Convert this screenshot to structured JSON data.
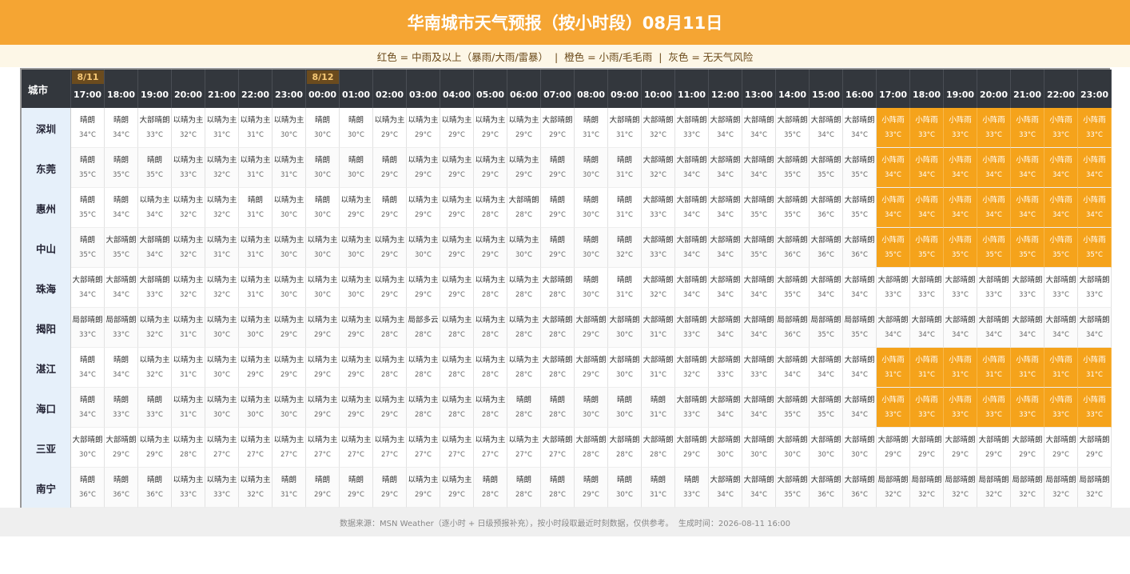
{
  "title": "华南城市天气预报（按小时段）08月11日",
  "legend": "红色 = 中雨及以上（暴雨/大雨/雷暴）  |  橙色 = 小雨/毛毛雨  |  灰色 = 无天气风险",
  "footer": "数据来源：MSN Weather（逐小时 + 日级预报补充），按小时段取最近时刻数据，仅供参考。  生成时间：2026-08-11 16:00",
  "colors": {
    "header": "#f5a533",
    "rain_cell": "#f5a31b",
    "header_row": "#33373d",
    "date_badge": "#6b4b1e",
    "city_col": "#e6f0fa"
  },
  "table": {
    "corner": "城市",
    "date_badges": [
      {
        "col": 0,
        "label": "8/11"
      },
      {
        "col": 7,
        "label": "8/12"
      }
    ],
    "hours": [
      "17:00",
      "18:00",
      "19:00",
      "20:00",
      "21:00",
      "22:00",
      "23:00",
      "00:00",
      "01:00",
      "02:00",
      "03:00",
      "04:00",
      "05:00",
      "06:00",
      "07:00",
      "08:00",
      "09:00",
      "10:00",
      "11:00",
      "12:00",
      "13:00",
      "14:00",
      "15:00",
      "16:00",
      "17:00",
      "18:00",
      "19:00",
      "20:00",
      "21:00",
      "22:00",
      "23:00"
    ],
    "rows": [
      {
        "city": "深圳",
        "cond": [
          "晴朗",
          "晴朗",
          "大部晴朗",
          "以晴为主",
          "以晴为主",
          "以晴为主",
          "以晴为主",
          "晴朗",
          "晴朗",
          "以晴为主",
          "以晴为主",
          "以晴为主",
          "以晴为主",
          "以晴为主",
          "大部晴朗",
          "晴朗",
          "大部晴朗",
          "大部晴朗",
          "大部晴朗",
          "大部晴朗",
          "大部晴朗",
          "大部晴朗",
          "大部晴朗",
          "大部晴朗",
          "小阵雨",
          "小阵雨",
          "小阵雨",
          "小阵雨",
          "小阵雨",
          "小阵雨",
          "小阵雨"
        ],
        "temp": [
          "34°C",
          "34°C",
          "33°C",
          "32°C",
          "31°C",
          "31°C",
          "30°C",
          "30°C",
          "30°C",
          "29°C",
          "29°C",
          "29°C",
          "29°C",
          "29°C",
          "29°C",
          "31°C",
          "31°C",
          "32°C",
          "33°C",
          "34°C",
          "34°C",
          "35°C",
          "34°C",
          "34°C",
          "33°C",
          "33°C",
          "33°C",
          "33°C",
          "33°C",
          "33°C",
          "33°C"
        ]
      },
      {
        "city": "东莞",
        "cond": [
          "晴朗",
          "晴朗",
          "晴朗",
          "以晴为主",
          "以晴为主",
          "以晴为主",
          "以晴为主",
          "晴朗",
          "晴朗",
          "晴朗",
          "以晴为主",
          "以晴为主",
          "以晴为主",
          "以晴为主",
          "晴朗",
          "晴朗",
          "晴朗",
          "大部晴朗",
          "大部晴朗",
          "大部晴朗",
          "大部晴朗",
          "大部晴朗",
          "大部晴朗",
          "大部晴朗",
          "小阵雨",
          "小阵雨",
          "小阵雨",
          "小阵雨",
          "小阵雨",
          "小阵雨",
          "小阵雨"
        ],
        "temp": [
          "35°C",
          "35°C",
          "35°C",
          "33°C",
          "32°C",
          "31°C",
          "31°C",
          "30°C",
          "30°C",
          "29°C",
          "29°C",
          "29°C",
          "29°C",
          "29°C",
          "29°C",
          "30°C",
          "31°C",
          "32°C",
          "34°C",
          "34°C",
          "34°C",
          "35°C",
          "35°C",
          "35°C",
          "34°C",
          "34°C",
          "34°C",
          "34°C",
          "34°C",
          "34°C",
          "34°C"
        ]
      },
      {
        "city": "惠州",
        "cond": [
          "晴朗",
          "晴朗",
          "以晴为主",
          "以晴为主",
          "以晴为主",
          "晴朗",
          "以晴为主",
          "晴朗",
          "以晴为主",
          "晴朗",
          "以晴为主",
          "以晴为主",
          "以晴为主",
          "大部晴朗",
          "晴朗",
          "晴朗",
          "晴朗",
          "大部晴朗",
          "大部晴朗",
          "大部晴朗",
          "大部晴朗",
          "大部晴朗",
          "大部晴朗",
          "大部晴朗",
          "小阵雨",
          "小阵雨",
          "小阵雨",
          "小阵雨",
          "小阵雨",
          "小阵雨",
          "小阵雨"
        ],
        "temp": [
          "35°C",
          "34°C",
          "34°C",
          "32°C",
          "32°C",
          "31°C",
          "30°C",
          "30°C",
          "29°C",
          "29°C",
          "29°C",
          "29°C",
          "28°C",
          "28°C",
          "29°C",
          "30°C",
          "31°C",
          "33°C",
          "34°C",
          "34°C",
          "35°C",
          "35°C",
          "36°C",
          "35°C",
          "34°C",
          "34°C",
          "34°C",
          "34°C",
          "34°C",
          "34°C",
          "34°C"
        ]
      },
      {
        "city": "中山",
        "cond": [
          "晴朗",
          "大部晴朗",
          "大部晴朗",
          "以晴为主",
          "以晴为主",
          "以晴为主",
          "以晴为主",
          "以晴为主",
          "以晴为主",
          "以晴为主",
          "以晴为主",
          "以晴为主",
          "以晴为主",
          "以晴为主",
          "晴朗",
          "晴朗",
          "晴朗",
          "大部晴朗",
          "大部晴朗",
          "大部晴朗",
          "大部晴朗",
          "大部晴朗",
          "大部晴朗",
          "大部晴朗",
          "小阵雨",
          "小阵雨",
          "小阵雨",
          "小阵雨",
          "小阵雨",
          "小阵雨",
          "小阵雨"
        ],
        "temp": [
          "35°C",
          "35°C",
          "34°C",
          "32°C",
          "31°C",
          "31°C",
          "30°C",
          "30°C",
          "30°C",
          "29°C",
          "30°C",
          "29°C",
          "29°C",
          "30°C",
          "29°C",
          "30°C",
          "32°C",
          "33°C",
          "34°C",
          "34°C",
          "35°C",
          "36°C",
          "36°C",
          "36°C",
          "35°C",
          "35°C",
          "35°C",
          "35°C",
          "35°C",
          "35°C",
          "35°C"
        ]
      },
      {
        "city": "珠海",
        "cond": [
          "大部晴朗",
          "大部晴朗",
          "大部晴朗",
          "以晴为主",
          "以晴为主",
          "以晴为主",
          "以晴为主",
          "以晴为主",
          "以晴为主",
          "以晴为主",
          "以晴为主",
          "以晴为主",
          "以晴为主",
          "以晴为主",
          "大部晴朗",
          "晴朗",
          "晴朗",
          "大部晴朗",
          "大部晴朗",
          "大部晴朗",
          "大部晴朗",
          "大部晴朗",
          "大部晴朗",
          "大部晴朗",
          "大部晴朗",
          "大部晴朗",
          "大部晴朗",
          "大部晴朗",
          "大部晴朗",
          "大部晴朗",
          "大部晴朗"
        ],
        "temp": [
          "34°C",
          "34°C",
          "33°C",
          "32°C",
          "32°C",
          "31°C",
          "30°C",
          "30°C",
          "30°C",
          "29°C",
          "29°C",
          "29°C",
          "28°C",
          "28°C",
          "28°C",
          "30°C",
          "31°C",
          "32°C",
          "34°C",
          "34°C",
          "34°C",
          "35°C",
          "34°C",
          "34°C",
          "33°C",
          "33°C",
          "33°C",
          "33°C",
          "33°C",
          "33°C",
          "33°C"
        ]
      },
      {
        "city": "揭阳",
        "cond": [
          "局部晴朗",
          "局部晴朗",
          "以晴为主",
          "以晴为主",
          "以晴为主",
          "以晴为主",
          "以晴为主",
          "以晴为主",
          "以晴为主",
          "以晴为主",
          "局部多云",
          "以晴为主",
          "以晴为主",
          "以晴为主",
          "大部晴朗",
          "大部晴朗",
          "大部晴朗",
          "大部晴朗",
          "大部晴朗",
          "大部晴朗",
          "大部晴朗",
          "局部晴朗",
          "局部晴朗",
          "局部晴朗",
          "大部晴朗",
          "大部晴朗",
          "大部晴朗",
          "大部晴朗",
          "大部晴朗",
          "大部晴朗",
          "大部晴朗"
        ],
        "temp": [
          "33°C",
          "33°C",
          "32°C",
          "31°C",
          "30°C",
          "30°C",
          "29°C",
          "29°C",
          "29°C",
          "28°C",
          "28°C",
          "28°C",
          "28°C",
          "28°C",
          "28°C",
          "29°C",
          "30°C",
          "31°C",
          "33°C",
          "34°C",
          "34°C",
          "36°C",
          "35°C",
          "35°C",
          "34°C",
          "34°C",
          "34°C",
          "34°C",
          "34°C",
          "34°C",
          "34°C"
        ]
      },
      {
        "city": "湛江",
        "cond": [
          "晴朗",
          "晴朗",
          "以晴为主",
          "以晴为主",
          "以晴为主",
          "以晴为主",
          "以晴为主",
          "以晴为主",
          "以晴为主",
          "以晴为主",
          "以晴为主",
          "以晴为主",
          "以晴为主",
          "以晴为主",
          "大部晴朗",
          "大部晴朗",
          "大部晴朗",
          "大部晴朗",
          "大部晴朗",
          "大部晴朗",
          "大部晴朗",
          "大部晴朗",
          "大部晴朗",
          "大部晴朗",
          "小阵雨",
          "小阵雨",
          "小阵雨",
          "小阵雨",
          "小阵雨",
          "小阵雨",
          "小阵雨"
        ],
        "temp": [
          "34°C",
          "34°C",
          "32°C",
          "31°C",
          "30°C",
          "29°C",
          "29°C",
          "29°C",
          "29°C",
          "28°C",
          "28°C",
          "28°C",
          "28°C",
          "28°C",
          "28°C",
          "29°C",
          "30°C",
          "31°C",
          "32°C",
          "33°C",
          "33°C",
          "34°C",
          "34°C",
          "34°C",
          "31°C",
          "31°C",
          "31°C",
          "31°C",
          "31°C",
          "31°C",
          "31°C"
        ]
      },
      {
        "city": "海口",
        "cond": [
          "晴朗",
          "晴朗",
          "晴朗",
          "以晴为主",
          "以晴为主",
          "以晴为主",
          "以晴为主",
          "以晴为主",
          "以晴为主",
          "以晴为主",
          "以晴为主",
          "以晴为主",
          "以晴为主",
          "晴朗",
          "晴朗",
          "晴朗",
          "晴朗",
          "晴朗",
          "大部晴朗",
          "大部晴朗",
          "大部晴朗",
          "大部晴朗",
          "大部晴朗",
          "大部晴朗",
          "小阵雨",
          "小阵雨",
          "小阵雨",
          "小阵雨",
          "小阵雨",
          "小阵雨",
          "小阵雨"
        ],
        "temp": [
          "34°C",
          "33°C",
          "33°C",
          "31°C",
          "30°C",
          "30°C",
          "30°C",
          "29°C",
          "29°C",
          "29°C",
          "28°C",
          "28°C",
          "28°C",
          "28°C",
          "28°C",
          "30°C",
          "30°C",
          "31°C",
          "33°C",
          "34°C",
          "34°C",
          "35°C",
          "35°C",
          "34°C",
          "33°C",
          "33°C",
          "33°C",
          "33°C",
          "33°C",
          "33°C",
          "33°C"
        ]
      },
      {
        "city": "三亚",
        "cond": [
          "大部晴朗",
          "大部晴朗",
          "以晴为主",
          "以晴为主",
          "以晴为主",
          "以晴为主",
          "以晴为主",
          "以晴为主",
          "以晴为主",
          "以晴为主",
          "以晴为主",
          "以晴为主",
          "以晴为主",
          "以晴为主",
          "大部晴朗",
          "大部晴朗",
          "大部晴朗",
          "大部晴朗",
          "大部晴朗",
          "大部晴朗",
          "大部晴朗",
          "大部晴朗",
          "大部晴朗",
          "大部晴朗",
          "大部晴朗",
          "大部晴朗",
          "大部晴朗",
          "大部晴朗",
          "大部晴朗",
          "大部晴朗",
          "大部晴朗"
        ],
        "temp": [
          "30°C",
          "29°C",
          "29°C",
          "28°C",
          "27°C",
          "27°C",
          "27°C",
          "27°C",
          "27°C",
          "27°C",
          "27°C",
          "27°C",
          "27°C",
          "27°C",
          "27°C",
          "28°C",
          "28°C",
          "28°C",
          "29°C",
          "30°C",
          "30°C",
          "30°C",
          "30°C",
          "30°C",
          "29°C",
          "29°C",
          "29°C",
          "29°C",
          "29°C",
          "29°C",
          "29°C"
        ]
      },
      {
        "city": "南宁",
        "cond": [
          "晴朗",
          "晴朗",
          "晴朗",
          "以晴为主",
          "以晴为主",
          "以晴为主",
          "晴朗",
          "晴朗",
          "晴朗",
          "晴朗",
          "以晴为主",
          "以晴为主",
          "晴朗",
          "晴朗",
          "晴朗",
          "晴朗",
          "晴朗",
          "晴朗",
          "晴朗",
          "大部晴朗",
          "大部晴朗",
          "大部晴朗",
          "大部晴朗",
          "大部晴朗",
          "局部晴朗",
          "局部晴朗",
          "局部晴朗",
          "局部晴朗",
          "局部晴朗",
          "局部晴朗",
          "局部晴朗"
        ],
        "temp": [
          "36°C",
          "36°C",
          "36°C",
          "33°C",
          "33°C",
          "32°C",
          "31°C",
          "29°C",
          "29°C",
          "29°C",
          "29°C",
          "29°C",
          "28°C",
          "28°C",
          "28°C",
          "29°C",
          "30°C",
          "31°C",
          "33°C",
          "34°C",
          "34°C",
          "35°C",
          "36°C",
          "36°C",
          "32°C",
          "32°C",
          "32°C",
          "32°C",
          "32°C",
          "32°C",
          "32°C"
        ]
      }
    ]
  }
}
